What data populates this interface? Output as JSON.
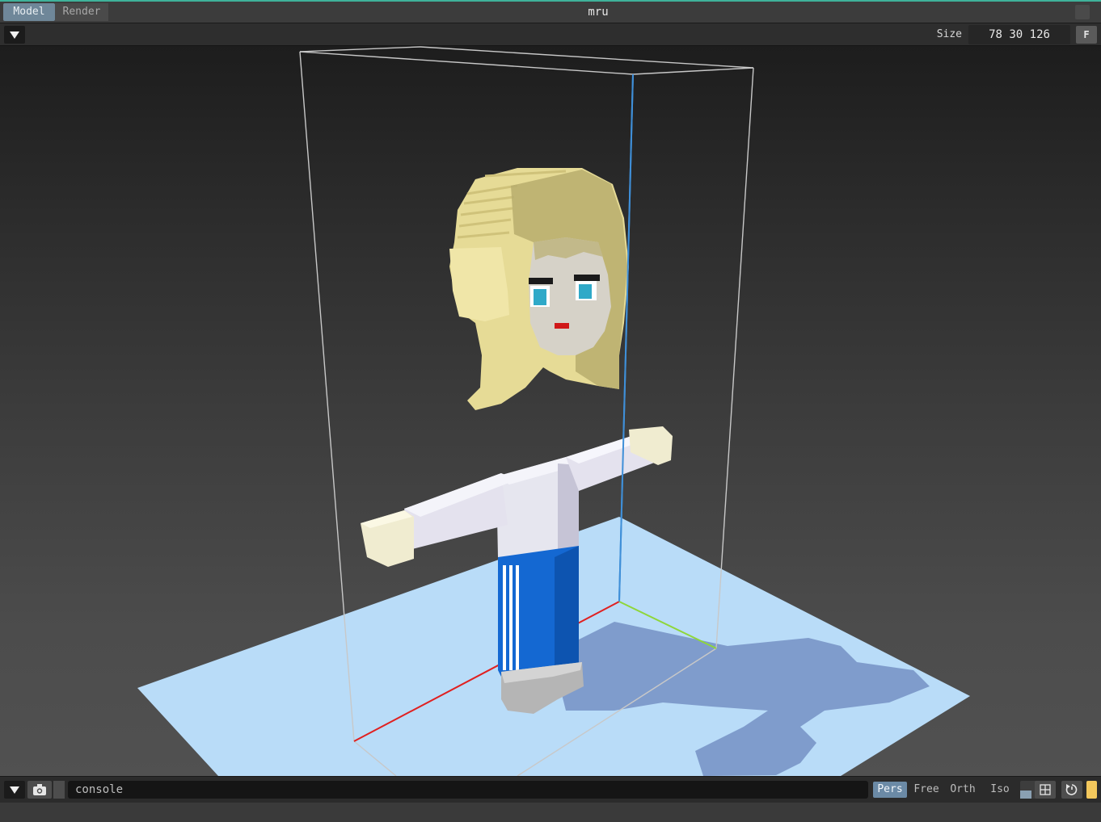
{
  "app": {
    "document_title": "mru"
  },
  "mode_tabs": [
    {
      "label": "Model",
      "active": true
    },
    {
      "label": "Render",
      "active": false
    }
  ],
  "toolbar": {
    "size_label": "Size",
    "size_value": "78 30 126",
    "fit_button_label": "F"
  },
  "console": {
    "placeholder": "console"
  },
  "projection": {
    "options": [
      "Pers",
      "Free",
      "Orth",
      "Iso"
    ],
    "selected": "Pers"
  },
  "viewport": {
    "scene_description_icons": [
      "voxel-model",
      "bounding-box",
      "ground-plane",
      "x-axis",
      "y-axis",
      "z-axis"
    ]
  },
  "colors": {
    "accent_active_tab": "#6f8799",
    "accent_projection": "#6b8aa6",
    "accent_swatch": "#f2c75c",
    "title_bar_border": "#3fb29a",
    "ground_plane": "#b9dcf8",
    "axis_x": "#e02020",
    "axis_y": "#8fd63a",
    "axis_z": "#3f8fd8"
  },
  "icons": {
    "menu_toggle": "triangle-down-icon",
    "camera": "camera-icon",
    "grid": "grid-icon",
    "rotate": "rotate-icon"
  }
}
